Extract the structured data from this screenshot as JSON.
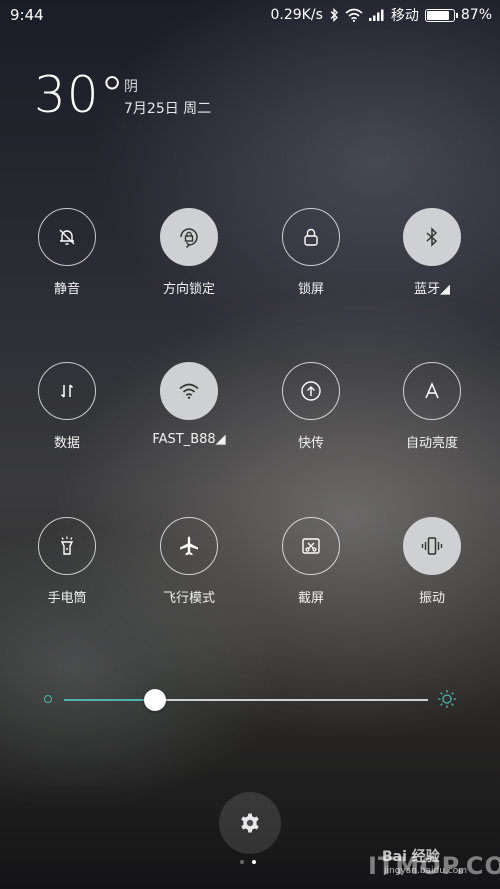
{
  "status_bar": {
    "time": "9:44",
    "speed": "0.29K/s",
    "carrier": "移动",
    "battery_text": "87%",
    "battery_level": 0.87,
    "icons": [
      "bluetooth-icon",
      "wifi-icon",
      "signal-icon",
      "battery-icon"
    ]
  },
  "weather": {
    "temperature": "30°",
    "condition": "阴",
    "date": "7月25日 周二"
  },
  "toggles": [
    {
      "label": "静音",
      "icon": "bell-off-icon",
      "on": false
    },
    {
      "label": "方向锁定",
      "icon": "rotation-lock-icon",
      "on": true
    },
    {
      "label": "锁屏",
      "icon": "lock-icon",
      "on": false
    },
    {
      "label": "蓝牙◢",
      "icon": "bluetooth-icon",
      "on": true
    },
    {
      "label": "数据",
      "icon": "mobile-data-icon",
      "on": false
    },
    {
      "label": "FAST_B88◢",
      "icon": "wifi-icon",
      "on": true
    },
    {
      "label": "快传",
      "icon": "upload-icon",
      "on": false
    },
    {
      "label": "自动亮度",
      "icon": "auto-brightness-icon",
      "on": false
    },
    {
      "label": "手电筒",
      "icon": "flashlight-icon",
      "on": false
    },
    {
      "label": "飞行模式",
      "icon": "airplane-icon",
      "on": false
    },
    {
      "label": "截屏",
      "icon": "screenshot-icon",
      "on": false
    },
    {
      "label": "振动",
      "icon": "vibrate-icon",
      "on": true
    }
  ],
  "brightness": {
    "level": 0.25,
    "accent": "#4fb3ad"
  },
  "pager": {
    "pages": 2,
    "current": 2
  },
  "watermark": {
    "baidu": "Bai 经验",
    "jingyan": "jingyan.baidu.com",
    "ithome": "ITMOP.COM"
  }
}
